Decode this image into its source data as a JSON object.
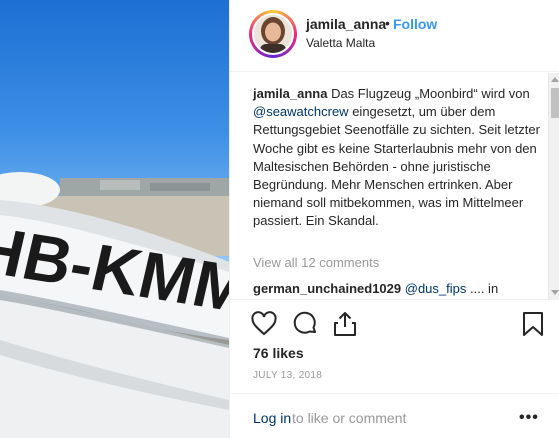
{
  "post": {
    "aircraft_registration": "HB-KMM"
  },
  "header": {
    "username": "jamila_anna",
    "separator": "•",
    "follow_label": "Follow",
    "location": "Valetta Malta"
  },
  "caption": {
    "username": "jamila_anna",
    "text_before_mention": "Das Flugzeug „Moonbird“ wird von",
    "mention": "@seawatchcrew",
    "text_after_mention": "eingesetzt, um über dem Rettungsgebiet Seenotfälle zu sichten. Seit letzter Woche gibt es keine Starterlaubnis mehr von den Maltesischen Behörden - ohne juristische Begründung. Mehr Menschen ertrinken. Aber niemand soll mitbekommen, was im Mittelmeer passiert. Ein Skandal."
  },
  "comments": {
    "view_all_label": "View all 12 comments",
    "first": {
      "username": "german_unchained1029",
      "mention": "@dus_fips",
      "text": ".... in"
    }
  },
  "actions": {
    "like_icon": "heart-icon",
    "comment_icon": "comment-bubble-icon",
    "share_icon": "share-icon",
    "save_icon": "bookmark-icon"
  },
  "likes_label": "76 likes",
  "date_label": "JULY 13, 2018",
  "footer": {
    "login_label": "Log in",
    "login_suffix": "to like or comment",
    "more_label": "•••"
  },
  "colors": {
    "link_blue": "#3897f0",
    "mention_blue": "#003569",
    "muted_gray": "#999999",
    "text_dark": "#262626",
    "border": "#efefef"
  }
}
